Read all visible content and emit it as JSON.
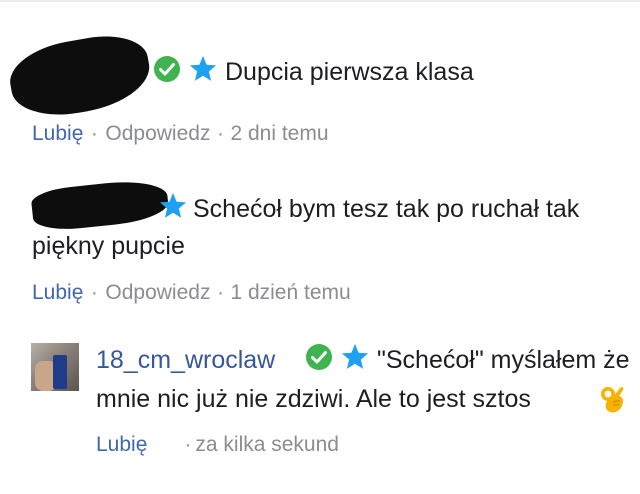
{
  "comments": [
    {
      "text_line1": "Dupcia pierwsza klasa",
      "like_label": "Lubię",
      "reply_label": "Odpowiedz",
      "timestamp": "2 dni temu"
    },
    {
      "text_line1": "Schećoł bym tesz tak po ruchał tak",
      "text_line2": "piękny pupcie",
      "like_label": "Lubię",
      "reply_label": "Odpowiedz",
      "timestamp": "1 dzień temu"
    },
    {
      "username": "18_cm_wroclaw",
      "text_line1": "\"Schećoł\" myślałem że",
      "text_line2": "mnie nic już nie zdziwi. Ale to jest sztos",
      "like_label": "Lubię",
      "timestamp": "za kilka sekund"
    }
  ],
  "separator": "·",
  "colors": {
    "verified_green": "#3fb34f",
    "star_blue": "#1ea1f2",
    "link_blue": "#4267b2",
    "meta_gray": "#8a8d91"
  },
  "icons": {
    "verified": "check-circle-icon",
    "top_fan": "star-icon",
    "emoji": "ok-hand-icon"
  }
}
